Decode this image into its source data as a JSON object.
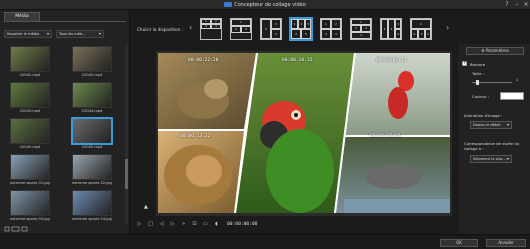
{
  "window": {
    "title": "Concepteur de collage vidéo",
    "help_icon": "?",
    "minimize_icon": "–",
    "close_icon": "×"
  },
  "left_panel": {
    "tab_label": "Média",
    "import_label": "Importer le média",
    "filter_label": "Tous les méd...",
    "items": [
      {
        "label": "C0041.mp4",
        "color": "#6f7c46"
      },
      {
        "label": "C0042.mp4",
        "color": "#7b6f59"
      },
      {
        "label": "C0043.mp4",
        "color": "#5f7a3e"
      },
      {
        "label": "C0044.mp4",
        "color": "#6b8b4d"
      },
      {
        "label": "C0045.mp4",
        "color": "#5b6f41"
      },
      {
        "label": "C0050.mp4",
        "color": "#6b6b6b"
      },
      {
        "label": "extreme sports 01.jpg",
        "color": "#8aa0b6"
      },
      {
        "label": "extreme sports 02.jpg",
        "color": "#9aa6b0"
      },
      {
        "label": "extreme sports 03.jpg",
        "color": "#7f95a8"
      },
      {
        "label": "extreme sports 04.jpg",
        "color": "#6d8bb2"
      },
      {
        "label": "extreme sports 05.jpg",
        "color": "#5f7fa6"
      },
      {
        "label": "extreme sports 06.jpg",
        "color": "#4f6f97"
      }
    ]
  },
  "layout_selector": {
    "label": "Choisir la disposition :",
    "options": [
      {
        "n": [
          "1",
          "2",
          "3",
          "4"
        ],
        "selected": false
      },
      {
        "n": [
          "1",
          "2",
          "3"
        ],
        "selected": false
      },
      {
        "n": [
          "2",
          "3",
          "4"
        ],
        "selected": false
      },
      {
        "n": [
          "1",
          "2",
          "3",
          "4",
          "5"
        ],
        "selected": true
      },
      {
        "n": [
          "1",
          "2",
          "3",
          "4"
        ],
        "selected": false
      },
      {
        "n": [
          "1",
          "2",
          "3",
          "4"
        ],
        "selected": false
      },
      {
        "n": [
          "1",
          "2",
          "3",
          "4"
        ],
        "selected": false
      },
      {
        "n": [
          "1",
          "2",
          "3",
          "4"
        ],
        "selected": false
      }
    ]
  },
  "preview": {
    "timestamps": [
      "00:00:22:28",
      "00:00:20:32",
      "00:00:06:15",
      "00:00:13:22",
      "00:00:20:08"
    ]
  },
  "playback": {
    "timecode": "00:00:00:00"
  },
  "right_panel": {
    "params_label": "Paramètres",
    "border_label": "Bordure",
    "size_label": "Taille :",
    "size_value": "1",
    "border_size_level": 0.1,
    "color_label": "Couleur :",
    "border_color": "#ffffff",
    "animation_label": "Animation d'image :",
    "animation_value": "Depuis le début",
    "duration_label": "Correspondance de durée du collage à :",
    "duration_value": "Séquence la plus ..."
  },
  "bottom": {
    "ok_label": "OK",
    "cancel_label": "Annuler"
  }
}
